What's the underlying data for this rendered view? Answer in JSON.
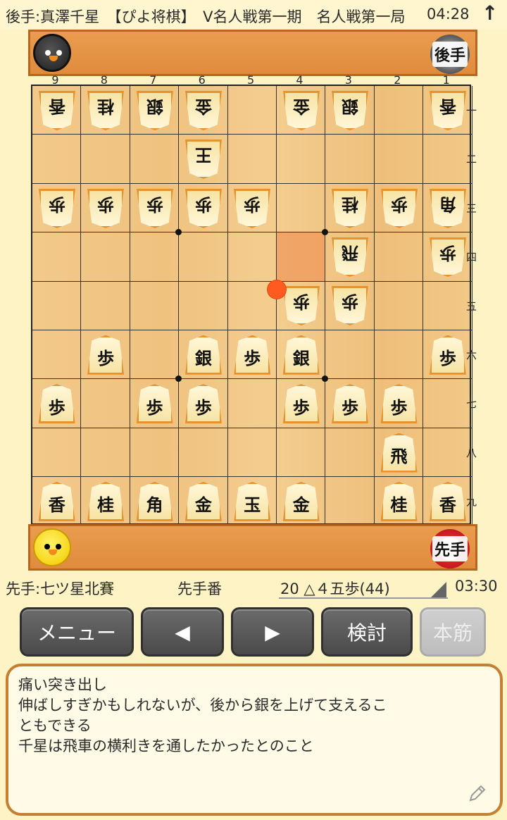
{
  "header": {
    "title": "後手:真澤千星　【ぴよ将棋】　V名人戦第一期　名人戦第一局",
    "time": "04:28",
    "arrow": "↑"
  },
  "gote_player": {
    "badge": "後手"
  },
  "sente_player": {
    "badge": "先手"
  },
  "board": {
    "files": [
      "9",
      "8",
      "7",
      "6",
      "5",
      "4",
      "3",
      "2",
      "1"
    ],
    "ranks": [
      "一",
      "二",
      "三",
      "四",
      "五",
      "六",
      "七",
      "八",
      "九"
    ],
    "pieces": [
      {
        "owner": "gote",
        "char": "香",
        "file": 9,
        "rank": 1
      },
      {
        "owner": "gote",
        "char": "桂",
        "file": 8,
        "rank": 1
      },
      {
        "owner": "gote",
        "char": "銀",
        "file": 7,
        "rank": 1
      },
      {
        "owner": "gote",
        "char": "金",
        "file": 6,
        "rank": 1
      },
      {
        "owner": "gote",
        "char": "金",
        "file": 4,
        "rank": 1
      },
      {
        "owner": "gote",
        "char": "銀",
        "file": 3,
        "rank": 1
      },
      {
        "owner": "gote",
        "char": "香",
        "file": 1,
        "rank": 1
      },
      {
        "owner": "gote",
        "char": "王",
        "file": 6,
        "rank": 2
      },
      {
        "owner": "gote",
        "char": "歩",
        "file": 9,
        "rank": 3
      },
      {
        "owner": "gote",
        "char": "歩",
        "file": 8,
        "rank": 3
      },
      {
        "owner": "gote",
        "char": "歩",
        "file": 7,
        "rank": 3
      },
      {
        "owner": "gote",
        "char": "歩",
        "file": 6,
        "rank": 3
      },
      {
        "owner": "gote",
        "char": "歩",
        "file": 5,
        "rank": 3
      },
      {
        "owner": "gote",
        "char": "桂",
        "file": 3,
        "rank": 3
      },
      {
        "owner": "gote",
        "char": "歩",
        "file": 2,
        "rank": 3
      },
      {
        "owner": "gote",
        "char": "角",
        "file": 1,
        "rank": 3
      },
      {
        "owner": "gote",
        "char": "飛",
        "file": 3,
        "rank": 4
      },
      {
        "owner": "gote",
        "char": "歩",
        "file": 1,
        "rank": 4
      },
      {
        "owner": "gote",
        "char": "歩",
        "file": 4,
        "rank": 5
      },
      {
        "owner": "gote",
        "char": "歩",
        "file": 3,
        "rank": 5
      },
      {
        "owner": "sente",
        "char": "歩",
        "file": 8,
        "rank": 6
      },
      {
        "owner": "sente",
        "char": "銀",
        "file": 6,
        "rank": 6
      },
      {
        "owner": "sente",
        "char": "歩",
        "file": 5,
        "rank": 6
      },
      {
        "owner": "sente",
        "char": "銀",
        "file": 4,
        "rank": 6
      },
      {
        "owner": "sente",
        "char": "歩",
        "file": 1,
        "rank": 6
      },
      {
        "owner": "sente",
        "char": "歩",
        "file": 9,
        "rank": 7
      },
      {
        "owner": "sente",
        "char": "歩",
        "file": 7,
        "rank": 7
      },
      {
        "owner": "sente",
        "char": "歩",
        "file": 6,
        "rank": 7
      },
      {
        "owner": "sente",
        "char": "歩",
        "file": 4,
        "rank": 7
      },
      {
        "owner": "sente",
        "char": "歩",
        "file": 3,
        "rank": 7
      },
      {
        "owner": "sente",
        "char": "歩",
        "file": 2,
        "rank": 7
      },
      {
        "owner": "sente",
        "char": "飛",
        "file": 2,
        "rank": 8
      },
      {
        "owner": "sente",
        "char": "香",
        "file": 9,
        "rank": 9
      },
      {
        "owner": "sente",
        "char": "桂",
        "file": 8,
        "rank": 9
      },
      {
        "owner": "sente",
        "char": "角",
        "file": 7,
        "rank": 9
      },
      {
        "owner": "sente",
        "char": "金",
        "file": 6,
        "rank": 9
      },
      {
        "owner": "sente",
        "char": "玉",
        "file": 5,
        "rank": 9
      },
      {
        "owner": "sente",
        "char": "金",
        "file": 4,
        "rank": 9
      },
      {
        "owner": "sente",
        "char": "桂",
        "file": 2,
        "rank": 9
      },
      {
        "owner": "sente",
        "char": "香",
        "file": 1,
        "rank": 9
      }
    ],
    "highlight": {
      "file": 4,
      "rank": 4
    }
  },
  "status": {
    "sente_name": "先手:七ツ星北賽",
    "turn": "先手番",
    "last_move": "20 △４五歩(44)",
    "time": "03:30"
  },
  "buttons": {
    "menu": "メニュー",
    "prev": "◀",
    "next": "▶",
    "analyze": "検討",
    "mainline": "本筋"
  },
  "comment": {
    "lines": [
      "痛い突き出し",
      "伸ばしすぎかもしれないが、後から銀を上げて支えるこ",
      "ともできる",
      "千星は飛車の横利きを通したかったとのこと"
    ]
  },
  "colors": {
    "background": "#fdf3c5",
    "stand": "#e08a3c",
    "board": "#f3c98a",
    "button": "#555555",
    "highlight": "#ee783c",
    "last_move_marker": "#ff5a1f"
  }
}
